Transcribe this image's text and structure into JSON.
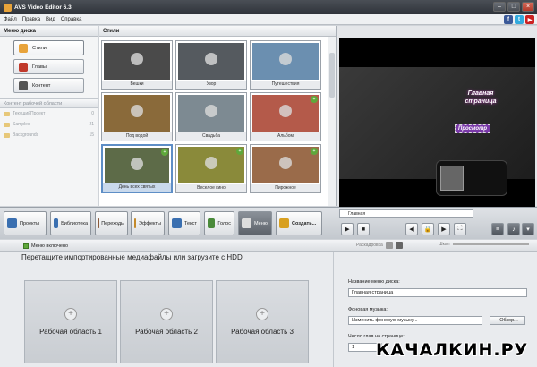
{
  "window": {
    "title": "AVS Video Editor 6.3"
  },
  "menu": [
    "Файл",
    "Правка",
    "Вид",
    "Справка"
  ],
  "social": [
    {
      "name": "facebook-icon",
      "letter": "f",
      "color": "#3b5998"
    },
    {
      "name": "twitter-icon",
      "letter": "t",
      "color": "#33aadd"
    },
    {
      "name": "youtube-icon",
      "letter": "▶",
      "color": "#cc2222"
    }
  ],
  "left": {
    "header": "Меню диска",
    "buttons": [
      {
        "label": "Стили",
        "active": true,
        "color": "#e8a33a"
      },
      {
        "label": "Главы",
        "active": false,
        "color": "#c0392b"
      },
      {
        "label": "Контент",
        "active": false,
        "color": "#555555"
      }
    ],
    "content_header": "Контент рабочей области",
    "folders": [
      {
        "name": "ТекущийПроект",
        "count": "0"
      },
      {
        "name": "Samples",
        "count": "21"
      },
      {
        "name": "Backgrounds",
        "count": "15"
      }
    ]
  },
  "gallery": {
    "header": "Стили",
    "thumbs": [
      {
        "label": "Вешки",
        "color": "#4a4a4a",
        "badge": false,
        "selected": false
      },
      {
        "label": "Узор",
        "color": "#555a5f",
        "badge": false,
        "selected": false
      },
      {
        "label": "Путешествия",
        "color": "#6b8fb0",
        "badge": false,
        "selected": false
      },
      {
        "label": "Под водой",
        "color": "#8a6a3a",
        "badge": false,
        "selected": false
      },
      {
        "label": "Свадьба",
        "color": "#7d8a92",
        "badge": false,
        "selected": false
      },
      {
        "label": "Альбом",
        "color": "#b45a4a",
        "badge": true,
        "selected": false
      },
      {
        "label": "День всех святых",
        "color": "#5d6b48",
        "badge": true,
        "selected": true
      },
      {
        "label": "Веселое кино",
        "color": "#8a8a3a",
        "badge": true,
        "selected": false
      },
      {
        "label": "Пирожное",
        "color": "#9a6b4a",
        "badge": true,
        "selected": false
      }
    ]
  },
  "preview": {
    "title_line1": "Главная",
    "title_line2": "страница",
    "button_text": "Просмотр"
  },
  "toolbar": [
    {
      "label": "Проекты",
      "on": false,
      "color": "#3a6fb0"
    },
    {
      "label": "Библиотека",
      "on": false,
      "color": "#3a6fb0"
    },
    {
      "label": "Переходы",
      "on": false,
      "color": "#8a5a3a"
    },
    {
      "label": "Эффекты",
      "on": false,
      "color": "#c48a2a"
    },
    {
      "label": "Текст",
      "on": false,
      "color": "#3a6fb0"
    },
    {
      "label": "Голос",
      "on": false,
      "color": "#4a8a3a"
    },
    {
      "label": "Меню",
      "on": true,
      "color": "#dddddd"
    },
    {
      "label": "Создать...",
      "on": false,
      "color": "#d8a020"
    }
  ],
  "player": {
    "timeline_label": "Главная"
  },
  "bottom": {
    "menu_enabled": "Меню включено",
    "rasclonka": "Раскадровка",
    "zoom_label": "Шкал",
    "drop_note": "Перетащите импортированные медиафайлы или загрузите с HDD",
    "areas": [
      "Рабочая область 1",
      "Рабочая область 2",
      "Рабочая область 3"
    ],
    "menu_name_label": "Название меню диска:",
    "menu_name_value": "Главная страница",
    "bg_music_label": "Фоновая музыка:",
    "bg_music_value": "Изменить фоновую музыку...",
    "browse_label": "Обзор...",
    "chapters_label": "Число глав на странице:",
    "chapters_value": "1"
  },
  "watermark": "КАЧАЛКИН.РУ"
}
